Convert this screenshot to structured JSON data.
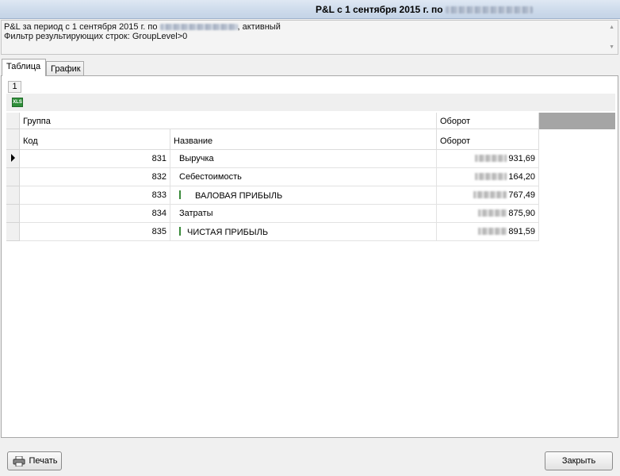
{
  "window": {
    "title": "P&L с 1 сентября 2015 г. по"
  },
  "info": {
    "line1_prefix": "P&L за период с 1 сентября 2015 г. по",
    "line1_suffix": ", активный",
    "line2": "Фильтр результирующих строк: GroupLevel>0"
  },
  "tabs": [
    {
      "label": "Таблица",
      "active": true
    },
    {
      "label": "График",
      "active": false
    }
  ],
  "page_button": "1",
  "toolbar": {
    "export_icon": "xls-export-icon",
    "export_text": "XLS"
  },
  "grid": {
    "group_header": {
      "left": "Группа",
      "right": "Оборот"
    },
    "columns": [
      "Код",
      "Название",
      "Оборот"
    ],
    "rows": [
      {
        "code": "831",
        "name": "Выручка",
        "turnover": "931,69",
        "marker": false
      },
      {
        "code": "832",
        "name": "Себестоимость",
        "turnover": "164,20",
        "marker": false
      },
      {
        "code": "833",
        "name": "ВАЛОВАЯ ПРИБЫЛЬ",
        "turnover": "767,49",
        "marker": true
      },
      {
        "code": "834",
        "name": "Затраты",
        "turnover": "875,90",
        "marker": false
      },
      {
        "code": "835",
        "name": "ЧИСТАЯ ПРИБЫЛЬ",
        "turnover": "891,59",
        "marker": true
      }
    ]
  },
  "buttons": {
    "print": "Печать",
    "close": "Закрыть"
  },
  "colors": {
    "titlebar": "#cfdcec",
    "grid_header_gray": "#a5a5a5",
    "marker_green": "#3a8a3a"
  }
}
